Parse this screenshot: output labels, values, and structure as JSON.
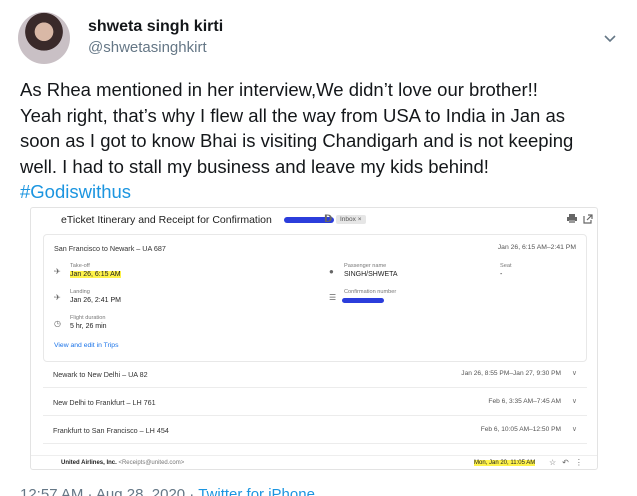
{
  "author": {
    "name": "shweta singh kirti",
    "handle": "@shwetasinghkirt"
  },
  "tweet": {
    "lines": [
      "As Rhea mentioned in her interview,We didn’t love our brother!!",
      "Yeah right, that’s why I flew all the way from USA to India in Jan as",
      "soon as I got to know Bhai is visiting Chandigarh and is not keeping",
      "well. I had to stall my business and leave my kids behind!"
    ],
    "hashtag": "#Godiswithus"
  },
  "email": {
    "title": "eTicket Itinerary and Receipt for Confirmation",
    "inbox_tag": "Inbox ×",
    "card": {
      "route": "San Francisco to Newark – UA 687",
      "dates": "Jan 26, 6:15 AM–2:41 PM",
      "takeoff_label": "Take-off",
      "takeoff_value": "Jan 26, 6:15 AM",
      "passenger_label": "Passenger name",
      "passenger_value": "SINGH/SHWETA",
      "seat_label": "Seat",
      "seat_value": "-",
      "landing_label": "Landing",
      "landing_value": "Jan 26, 2:41 PM",
      "confirmation_label": "Confirmation number",
      "duration_label": "Flight duration",
      "duration_value": "5 hr, 26 min",
      "link": "View and edit in Trips"
    },
    "flights": [
      {
        "route": "Newark to New Delhi – UA 82",
        "dates": "Jan 26, 8:55 PM–Jan 27, 9:30 PM"
      },
      {
        "route": "New Delhi to Frankfurt – LH 761",
        "dates": "Feb 6, 3:35 AM–7:45 AM"
      },
      {
        "route": "Frankfurt to San Francisco – LH 454",
        "dates": "Feb 6, 10:05 AM–12:50 PM"
      }
    ],
    "footer": {
      "sender": "United Airlines, Inc.",
      "sender_email": "<Receipts@united.com>",
      "date": "Mon, Jan 20, 11:05 AM"
    }
  },
  "meta": {
    "time": "12:57 AM · Aug 28, 2020 · ",
    "source": "Twitter for iPhone"
  },
  "colors": {
    "link": "#1b95e0",
    "highlight": "#fff34a",
    "redaction": "#2b3ddb"
  }
}
